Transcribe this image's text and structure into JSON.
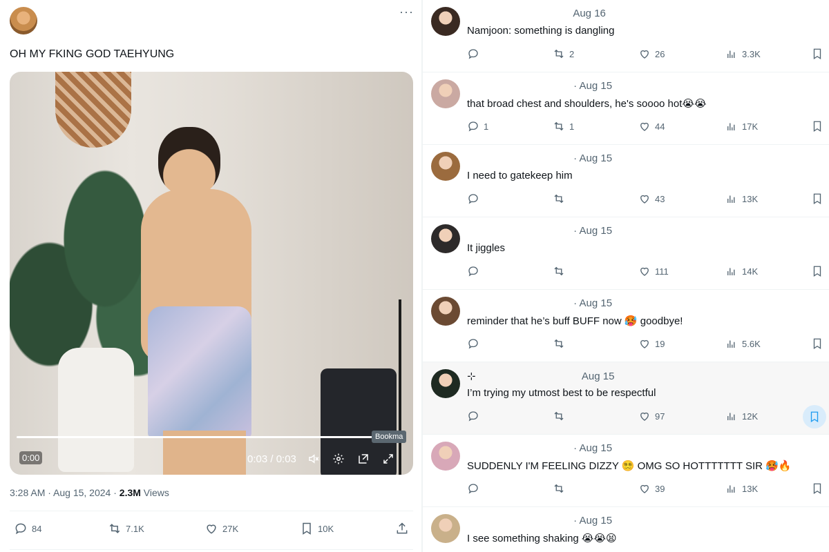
{
  "tweet": {
    "text": "OH MY FKING GOD TAEHYUNG",
    "more": "···",
    "video": {
      "progress": 1.0,
      "time_badge": "0:00",
      "time": "0:03 / 0:03"
    },
    "time": "3:28 AM · Aug 15, 2024 ·",
    "views_count": "2.3M",
    "views_label": "Views",
    "stats": {
      "replies": "84",
      "reposts": "7.1K",
      "likes": "27K",
      "bookmarks": "10K"
    }
  },
  "replies": [
    {
      "date": "Aug 16",
      "text": "Namjoon: something is dangling",
      "replies": "",
      "reposts": "2",
      "likes": "26",
      "views": "3.3K",
      "avatar_color": "#3a2a22"
    },
    {
      "date": "· Aug 15",
      "text": "that broad chest and shoulders, he's soooo hot😭😭",
      "replies": "1",
      "reposts": "1",
      "likes": "44",
      "views": "17K",
      "avatar_color": "#caa9a2"
    },
    {
      "date": "· Aug 15",
      "text": "I need to gatekeep him",
      "replies": "",
      "reposts": "",
      "likes": "43",
      "views": "13K",
      "avatar_color": "#9b6b3e"
    },
    {
      "date": "· Aug 15",
      "text": "It jiggles",
      "replies": "",
      "reposts": "",
      "likes": "111",
      "views": "14K",
      "avatar_color": "#2d2a2a"
    },
    {
      "date": "· Aug 15",
      "text": "reminder that he’s buff BUFF now 🥵 goodbye!",
      "replies": "",
      "reposts": "",
      "likes": "19",
      "views": "5.6K",
      "avatar_color": "#6b4a33"
    },
    {
      "date": "Aug 15",
      "handle_prefix": "⊹",
      "text": "I’m trying my utmost best to be respectful",
      "replies": "",
      "reposts": "",
      "likes": "97",
      "views": "12K",
      "avatar_color": "#1e2a22"
    },
    {
      "date": "· Aug 15",
      "text": "SUDDENLY I'M FEELING DIZZY 😵‍💫 OMG SO HOTTTTTTT SIR 🥵🔥",
      "replies": "",
      "reposts": "",
      "likes": "39",
      "views": "13K",
      "avatar_color": "#d8a8b8"
    },
    {
      "date": "· Aug 15",
      "text": "I see something shaking 😭😭😫",
      "replies": "",
      "reposts": "",
      "likes": "",
      "views": "",
      "avatar_color": "#c9b08a"
    }
  ],
  "tooltip": "Bookma",
  "icons": {
    "reply": "reply-icon",
    "repost": "repost-icon",
    "like": "heart-icon",
    "views": "views-icon",
    "bookmark": "bookmark-icon",
    "share": "share-icon"
  }
}
